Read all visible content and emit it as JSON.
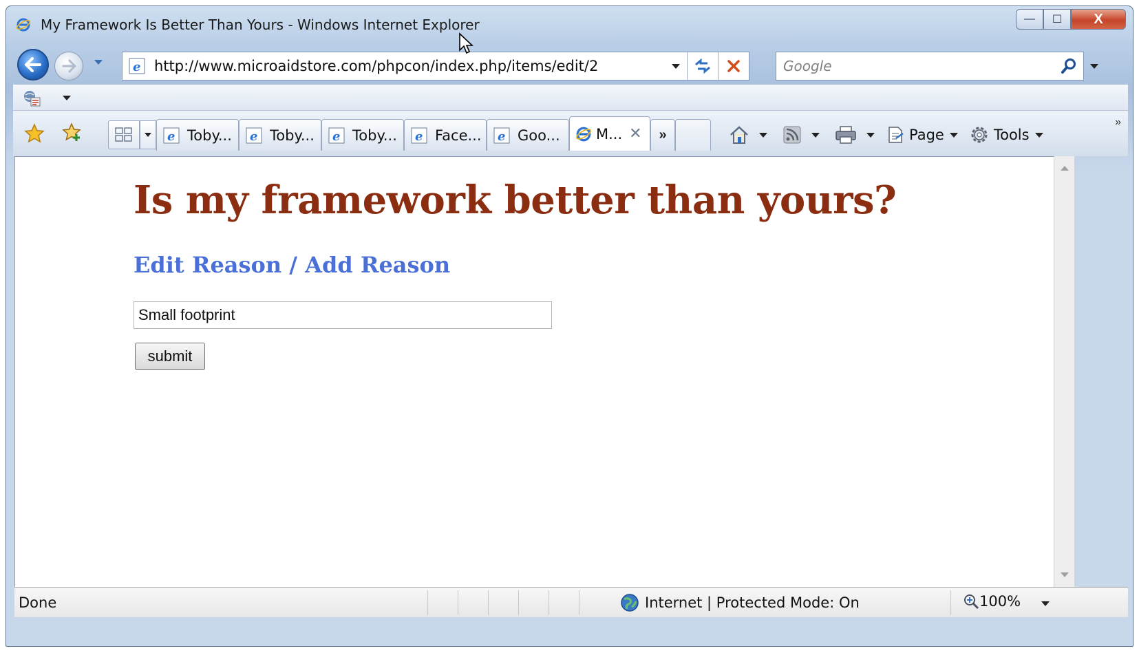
{
  "window": {
    "title": "My Framework Is Better Than Yours - Windows Internet Explorer",
    "controls": {
      "minimize": "—",
      "maximize": "☐",
      "close": "X"
    }
  },
  "navigation": {
    "url": "http://www.microaidstore.com/phpcon/index.php/items/edit/2",
    "search_placeholder": "Google"
  },
  "tabs": [
    {
      "label": "Toby...",
      "active": false
    },
    {
      "label": "Toby...",
      "active": false
    },
    {
      "label": "Toby...",
      "active": false
    },
    {
      "label": "Face...",
      "active": false
    },
    {
      "label": "Goo...",
      "active": false
    },
    {
      "label": "M...",
      "active": true
    }
  ],
  "tab_overflow": "»",
  "toolbar": {
    "page_label": "Page",
    "tools_label": "Tools",
    "chevrons": "»"
  },
  "page": {
    "title": "Is my framework better than yours?",
    "subtitle": "Edit Reason / Add Reason",
    "reason_value": "Small footprint",
    "submit_label": "submit"
  },
  "status": {
    "text": "Done",
    "zone": "Internet | Protected Mode: On",
    "zoom": "100%"
  },
  "colors": {
    "title": "#8a2d10",
    "subtitle": "#4a6fd6"
  }
}
